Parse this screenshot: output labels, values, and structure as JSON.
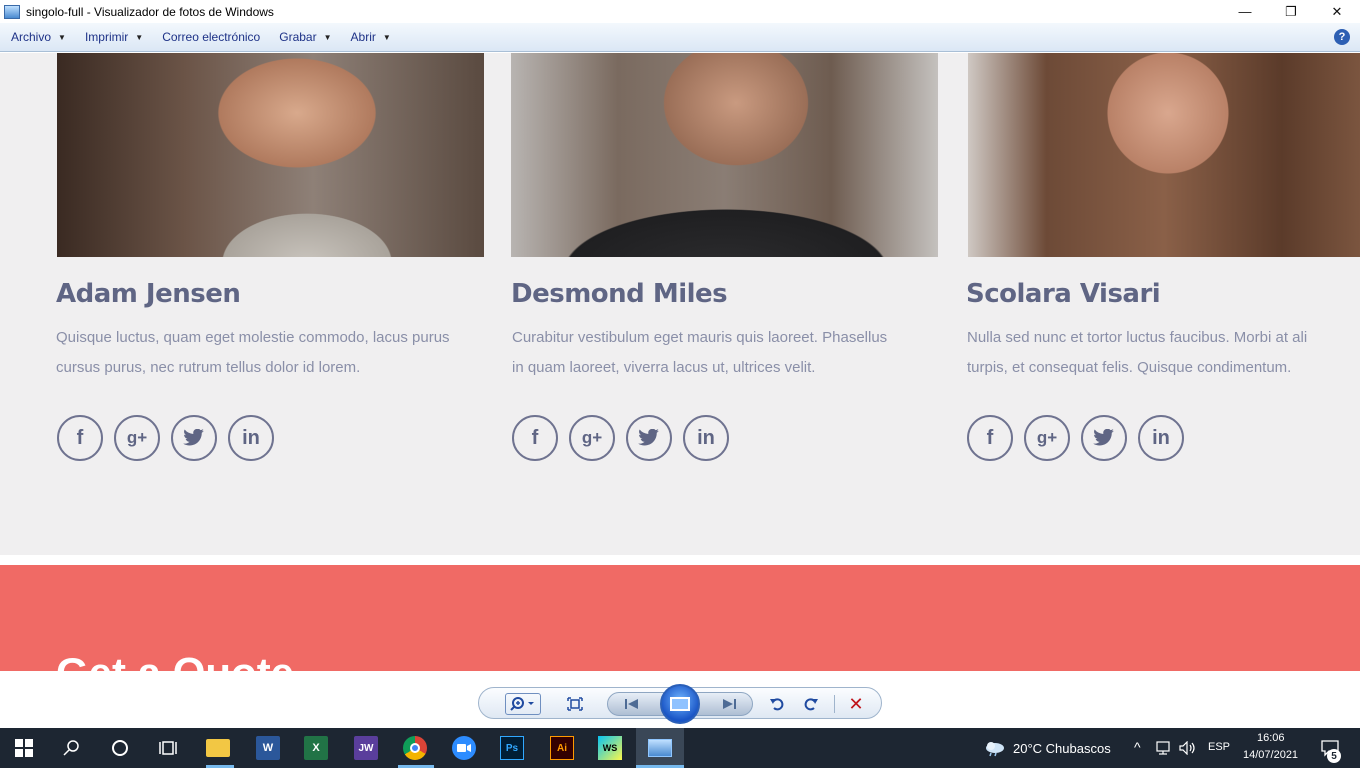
{
  "window": {
    "title": "singolo-full - Visualizador de fotos de Windows",
    "controls": [
      "—",
      "❐",
      "✕"
    ]
  },
  "menu": {
    "items": [
      "Archivo",
      "Imprimir",
      "Correo electrónico",
      "Grabar",
      "Abrir"
    ],
    "help": "?"
  },
  "page": {
    "members": [
      {
        "name": "Adam Jensen",
        "desc_line1": "Quisque luctus, quam eget molestie commodo, lacus purus",
        "desc_line2": "cursus purus, nec rutrum tellus dolor id lorem."
      },
      {
        "name": "Desmond Miles",
        "desc_line1": "Curabitur vestibulum eget mauris quis laoreet. Phasellus",
        "desc_line2": "in quam laoreet, viverra lacus ut, ultrices velit."
      },
      {
        "name": "Scolara Visari",
        "desc_line1": "Nulla sed nunc et tortor luctus faucibus. Morbi at ali",
        "desc_line2": "turpis, et consequat felis. Quisque condimentum."
      }
    ],
    "social_icons": [
      "facebook-icon",
      "google-plus-icon",
      "twitter-icon",
      "linkedin-icon"
    ],
    "social_labels": [
      "f",
      "g+",
      "t",
      "in"
    ],
    "quote_heading": "Get a Quote"
  },
  "taskbar": {
    "weather": "20°C  Chubascos",
    "language": "ESP",
    "time": "16:06",
    "date": "14/07/2021",
    "notifications": "5",
    "apps": [
      "file-explorer",
      "word",
      "excel",
      "jw",
      "chrome",
      "zoom",
      "photoshop",
      "illustrator",
      "webstorm",
      "photo-viewer"
    ]
  },
  "colors": {
    "accent_red": "#f06a65",
    "name_color": "#5f6584",
    "page_bg": "#f0eff0"
  }
}
